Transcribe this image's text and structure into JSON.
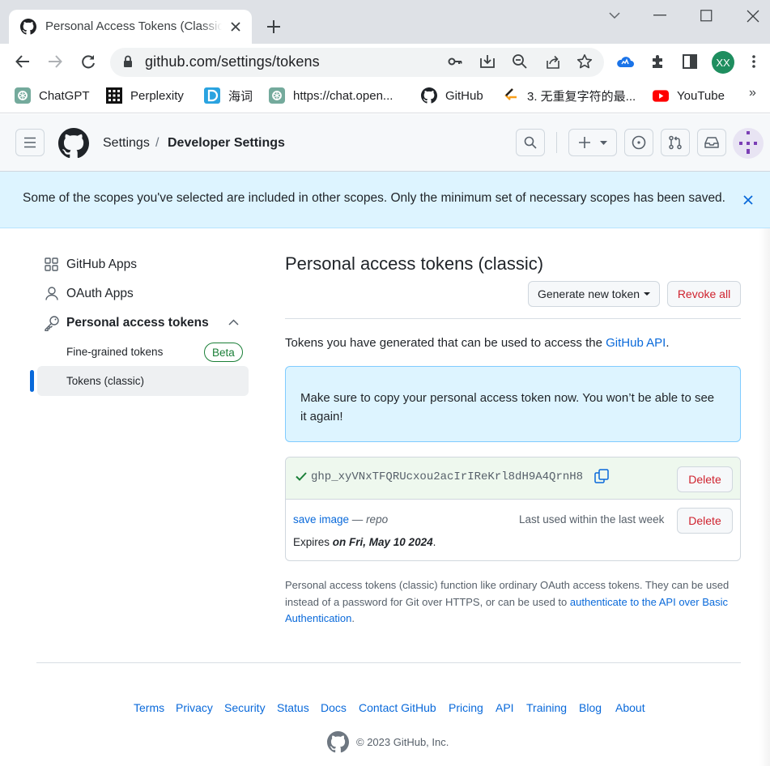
{
  "browser": {
    "tab_title": "Personal Access Tokens (Classic)",
    "url": "github.com/settings/tokens",
    "profile_initials": "XX",
    "bookmarks": [
      {
        "label": "ChatGPT",
        "icon": "openai-icon"
      },
      {
        "label": "Perplexity",
        "icon": "perplexity-icon"
      },
      {
        "label": "海词",
        "icon": "dict-icon"
      },
      {
        "label": "https://chat.open...",
        "icon": "openai-icon"
      },
      {
        "label": "GitHub",
        "icon": "github-icon"
      },
      {
        "label": "3. 无重复字符的最...",
        "icon": "leetcode-icon"
      },
      {
        "label": "YouTube",
        "icon": "youtube-icon"
      }
    ],
    "more_bookmarks": "»"
  },
  "header": {
    "breadcrumb_root": "Settings",
    "breadcrumb_sep": "/",
    "breadcrumb_current": "Developer Settings"
  },
  "flash": {
    "message": "Some of the scopes you've selected are included in other scopes. Only the minimum set of necessary scopes has been saved."
  },
  "sidebar": {
    "github_apps": "GitHub Apps",
    "oauth_apps": "OAuth Apps",
    "personal_access_tokens": "Personal access tokens",
    "fine_grained": "Fine-grained tokens",
    "beta": "Beta",
    "classic": "Tokens (classic)"
  },
  "main": {
    "title": "Personal access tokens (classic)",
    "generate_button": "Generate new token",
    "revoke_button": "Revoke all",
    "intro_text": "Tokens you have generated that can be used to access the ",
    "intro_link": "GitHub API",
    "intro_end": ".",
    "notice": "Make sure to copy your personal access token now. You won’t be able to see it again!",
    "token_value": "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",
    "delete_label": "Delete",
    "token_name": "save image",
    "token_dash": " — ",
    "token_scope": "repo",
    "last_used": "Last used within the last week",
    "expires_prefix": "Expires ",
    "expires_date": "on Fri, May 10 2024",
    "expires_end": ".",
    "description_text": "Personal access tokens (classic) function like ordinary OAuth access tokens. They can be used instead of a password for Git over HTTPS, or can be used to ",
    "description_link": "authenticate to the API over Basic Authentication",
    "description_end": "."
  },
  "footer": {
    "links": [
      "Terms",
      "Privacy",
      "Security",
      "Status",
      "Docs",
      "Contact GitHub",
      "Pricing",
      "API",
      "Training",
      "Blog",
      "About"
    ],
    "copyright": "© 2023 GitHub, Inc."
  },
  "colors": {
    "accent": "#0969da",
    "danger": "#cf222e",
    "success": "#1a7f37",
    "flash_bg": "#ddf4ff"
  }
}
